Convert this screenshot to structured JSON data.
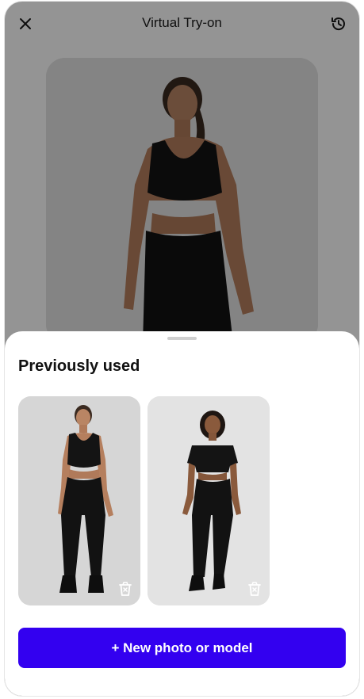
{
  "header": {
    "title": "Virtual Try-on",
    "close_icon": "close-icon",
    "history_icon": "history-icon"
  },
  "sheet": {
    "title": "Previously used",
    "items": [
      {
        "label": "Model in black sports bra and leggings",
        "delete_icon": "trash-icon"
      },
      {
        "label": "Model in black crop tee and leggings",
        "delete_icon": "trash-icon"
      }
    ],
    "new_button_label": "+ New photo or model"
  },
  "colors": {
    "accent": "#3300f0",
    "overlay": "rgba(0,0,0,0.42)"
  }
}
